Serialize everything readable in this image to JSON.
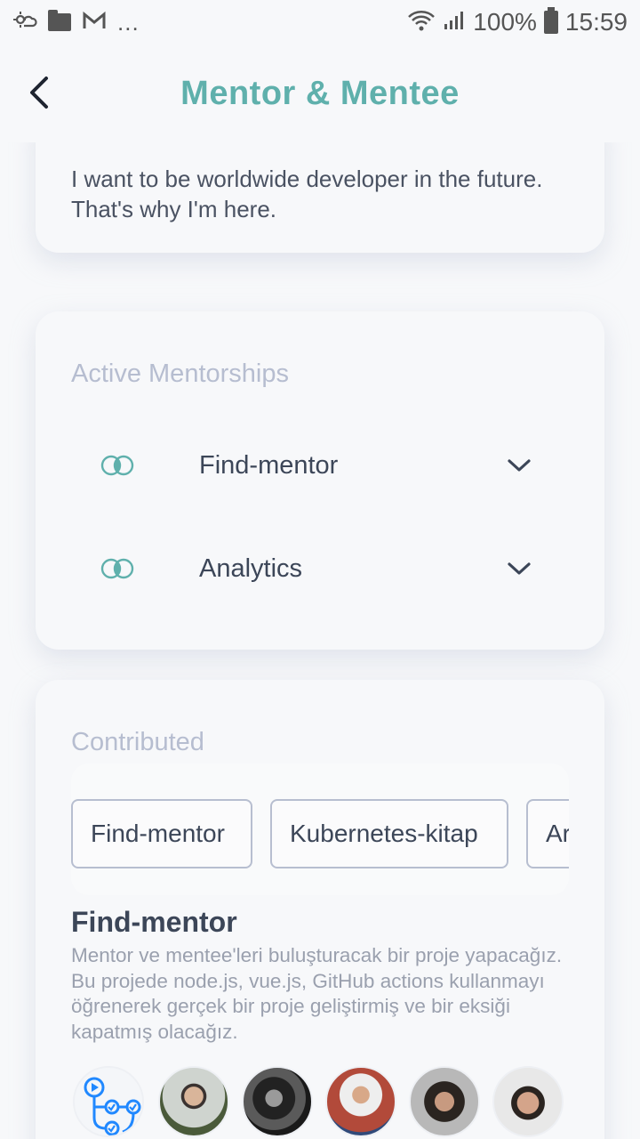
{
  "status_bar": {
    "battery": "100%",
    "time": "15:59",
    "overflow": "..."
  },
  "header": {
    "title": "Mentor & Mentee"
  },
  "about": {
    "text": "I want to be worldwide developer in the future. That's why I'm here."
  },
  "active_mentorships": {
    "label": "Active Mentorships",
    "items": [
      {
        "name": "Find-mentor"
      },
      {
        "name": "Analytics"
      }
    ]
  },
  "contributed": {
    "label": "Contributed",
    "chips": [
      "Find-mentor",
      "Kubernetes-kitap",
      "Ar"
    ],
    "selected_project": {
      "title": "Find-mentor",
      "description": "Mentor ve mentee'leri buluşturacak bir proje yapacağız. Bu projede node.js, vue.js, GitHub actions kullanmayı öğrenerek gerçek bir proje geliştirmiş ve bir eksiği kapatmış olacağız."
    },
    "avatars": [
      "github-actions-logo",
      "avatar-2",
      "avatar-3",
      "avatar-4",
      "avatar-5",
      "avatar-6"
    ]
  },
  "colors": {
    "accent": "#5fb0ac",
    "label": "#b6bdd0",
    "text": "#3c4658"
  }
}
